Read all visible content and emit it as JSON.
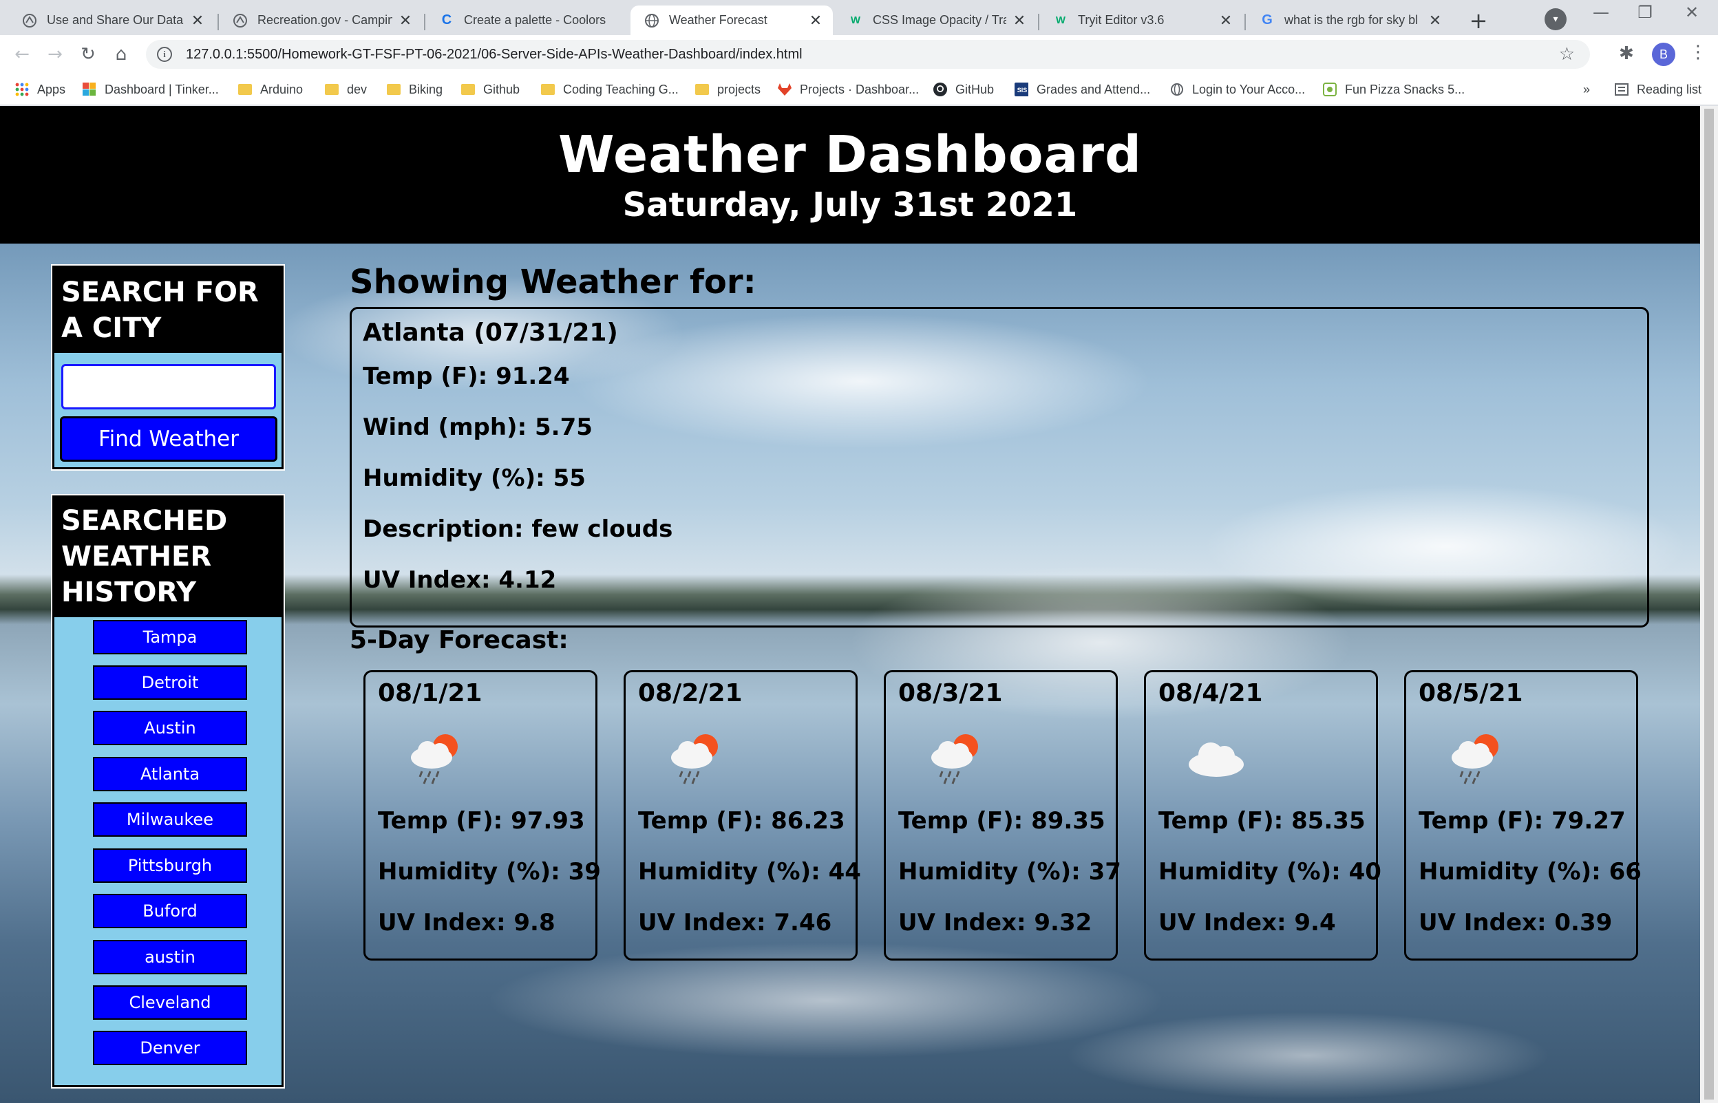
{
  "browser": {
    "tabs": [
      {
        "label": "Use and Share Our Data",
        "icon": "recreation-icon",
        "active": false
      },
      {
        "label": "Recreation.gov - Camping",
        "icon": "recreation-icon",
        "active": false
      },
      {
        "label": "Create a palette - Coolors",
        "icon": "coolors-icon",
        "active": false
      },
      {
        "label": "Weather Forecast",
        "icon": "globe-icon",
        "active": true
      },
      {
        "label": "CSS Image Opacity / Tran",
        "icon": "w3schools-icon",
        "active": false
      },
      {
        "label": "Tryit Editor v3.6",
        "icon": "w3schools-icon",
        "active": false
      },
      {
        "label": "what is the rgb for sky bl",
        "icon": "google-icon",
        "active": false
      }
    ],
    "url": "127.0.0.1:5500/Homework-GT-FSF-PT-06-2021/06-Server-Side-APIs-Weather-Dashboard/index.html",
    "profile_initial": "B",
    "bookmarks": [
      {
        "label": "Apps",
        "icon": "apps-grid-icon"
      },
      {
        "label": "Dashboard | Tinker...",
        "icon": "tinkercad-icon"
      },
      {
        "label": "Arduino",
        "icon": "folder-icon"
      },
      {
        "label": "dev",
        "icon": "folder-icon"
      },
      {
        "label": "Biking",
        "icon": "folder-icon"
      },
      {
        "label": "Github",
        "icon": "folder-icon"
      },
      {
        "label": "Coding Teaching G...",
        "icon": "folder-icon"
      },
      {
        "label": "projects",
        "icon": "folder-icon"
      },
      {
        "label": "Projects · Dashboar...",
        "icon": "gitlab-icon"
      },
      {
        "label": "GitHub",
        "icon": "github-icon"
      },
      {
        "label": "Grades and Attend...",
        "icon": "sis-icon"
      },
      {
        "label": "Login to Your Acco...",
        "icon": "globe-icon"
      },
      {
        "label": "Fun Pizza Snacks 5...",
        "icon": "pizza-icon"
      }
    ],
    "bookmarks_more": "»",
    "reading_list": "Reading list"
  },
  "header": {
    "title": "Weather Dashboard",
    "date": "Saturday, July 31st 2021"
  },
  "search": {
    "title": "SEARCH FOR A CITY",
    "input_value": "",
    "button_label": "Find Weather"
  },
  "history": {
    "title": "SEARCHED WEATHER HISTORY",
    "cities": [
      "Tampa",
      "Detroit",
      "Austin",
      "Atlanta",
      "Milwaukee",
      "Pittsburgh",
      "Buford",
      "austin",
      "Cleveland",
      "Denver"
    ]
  },
  "current": {
    "heading": "Showing Weather for:",
    "city_date": "Atlanta (07/31/21)",
    "temp": "Temp (F): 91.24",
    "wind": "Wind (mph): 5.75",
    "humidity": "Humidity (%): 55",
    "description": "Description: few clouds",
    "uv": "UV Index: 4.12"
  },
  "forecast": {
    "heading": "5-Day Forecast:",
    "days": [
      {
        "date": "08/1/21",
        "icon": "rain-sun-cloud-icon",
        "temp": "Temp (F): 97.93",
        "humidity": "Humidity (%): 39",
        "uv": "UV Index: 9.8"
      },
      {
        "date": "08/2/21",
        "icon": "rain-sun-cloud-icon",
        "temp": "Temp (F): 86.23",
        "humidity": "Humidity (%): 44",
        "uv": "UV Index: 7.46"
      },
      {
        "date": "08/3/21",
        "icon": "rain-sun-cloud-icon",
        "temp": "Temp (F): 89.35",
        "humidity": "Humidity (%): 37",
        "uv": "UV Index: 9.32"
      },
      {
        "date": "08/4/21",
        "icon": "cloud-icon",
        "temp": "Temp (F): 85.35",
        "humidity": "Humidity (%): 40",
        "uv": "UV Index: 9.4"
      },
      {
        "date": "08/5/21",
        "icon": "rain-sun-cloud-icon",
        "temp": "Temp (F): 79.27",
        "humidity": "Humidity (%): 66",
        "uv": "UV Index: 0.39"
      }
    ]
  }
}
